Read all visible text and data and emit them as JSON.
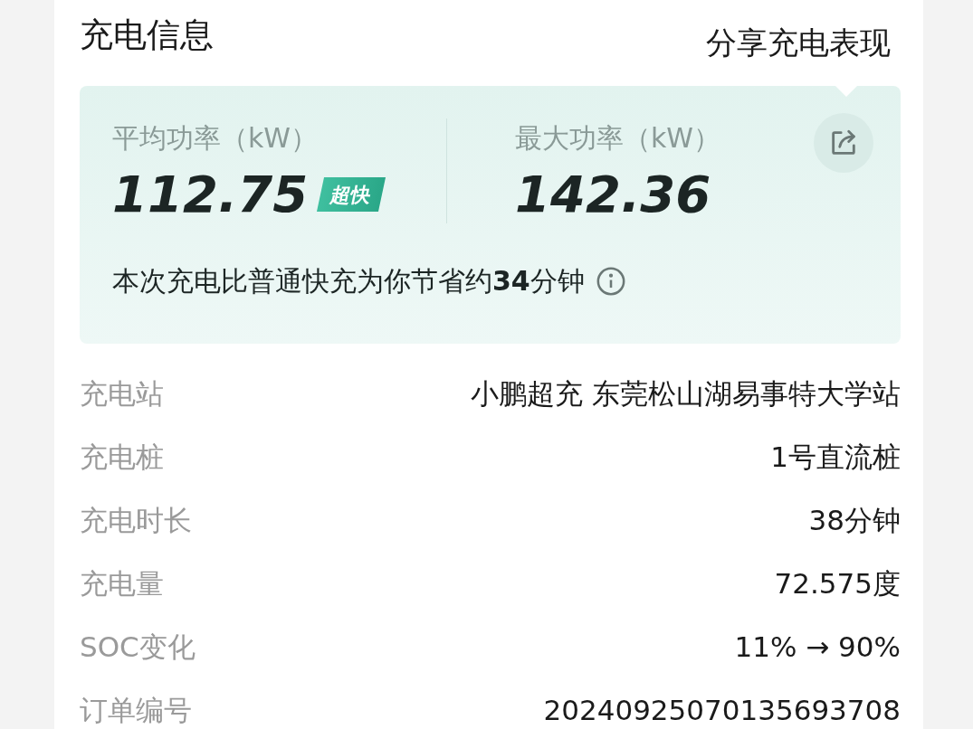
{
  "section_title": "充电信息",
  "tooltip": {
    "text": "分享充电表现"
  },
  "stats": [
    {
      "label": "平均功率（kW）",
      "value": "112.75",
      "badge": "超快"
    },
    {
      "label": "最大功率（kW）",
      "value": "142.36"
    }
  ],
  "savings_note": "本次充电比普通快充为你节省约**34**分钟",
  "details": [
    {
      "label": "充电站",
      "value": "小鹏超充 东莞松山湖易事特大学站"
    },
    {
      "label": "充电桩",
      "value": "1号直流桩"
    },
    {
      "label": "充电时长",
      "value": "38分钟"
    },
    {
      "label": "充电量",
      "value": "72.575度"
    },
    {
      "label": "SOC变化",
      "value": "11% → 90%"
    },
    {
      "label": "订单编号",
      "value": "20240925070135693708"
    }
  ]
}
